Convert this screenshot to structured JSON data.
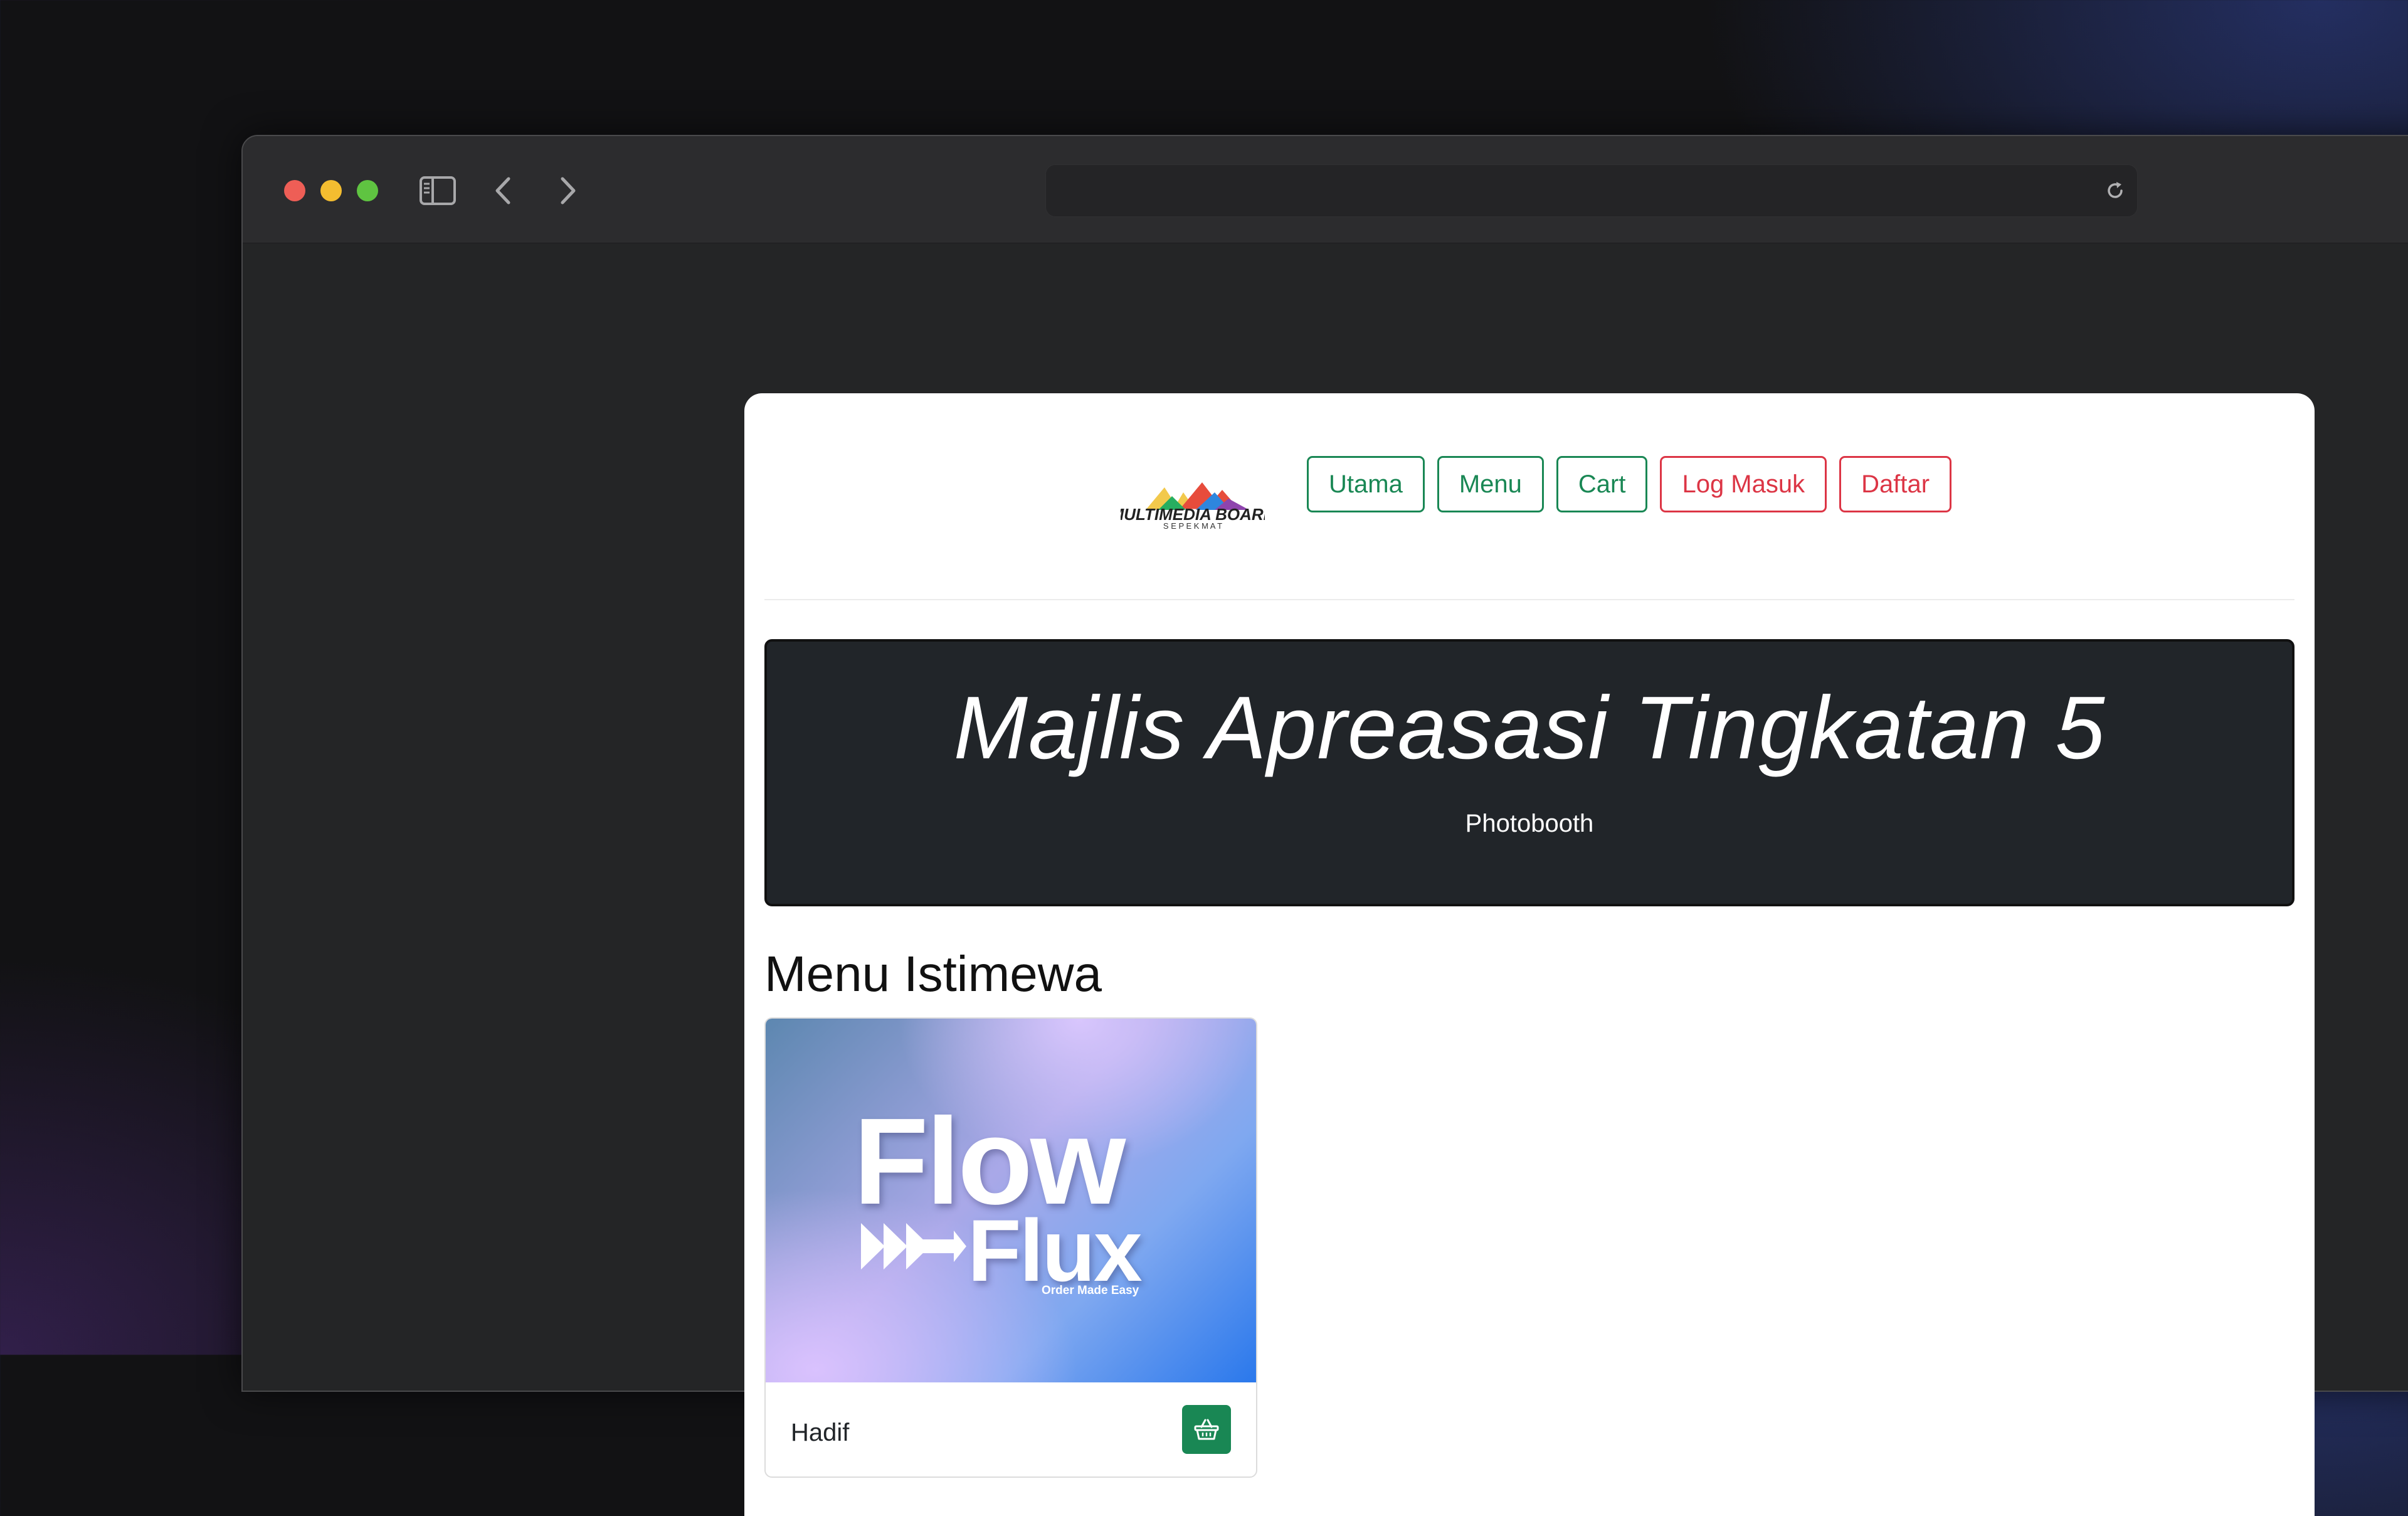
{
  "colors": {
    "success": "#198754",
    "danger": "#dc3545",
    "hero_bg": "#212529",
    "window_chrome": "#2c2c2e"
  },
  "browser": {
    "traffic_lights": [
      "close",
      "minimize",
      "maximize"
    ],
    "icons": [
      "sidebar-icon",
      "back-arrow-icon",
      "forward-arrow-icon",
      "reload-icon"
    ],
    "url": ""
  },
  "navbar": {
    "logo": {
      "icon": "multimedia-board-logo",
      "text_line1": "MULTIMEDIA BOARD",
      "text_line2": "S E P E K M A T"
    },
    "buttons": [
      {
        "label": "Utama",
        "variant": "success"
      },
      {
        "label": "Menu",
        "variant": "success"
      },
      {
        "label": "Cart",
        "variant": "success"
      },
      {
        "label": "Log Masuk",
        "variant": "danger"
      },
      {
        "label": "Daftar",
        "variant": "danger"
      }
    ]
  },
  "hero": {
    "title": "Majlis Apreasasi Tingkatan 5",
    "subtitle": "Photobooth"
  },
  "section": {
    "title": "Menu Istimewa"
  },
  "cards": [
    {
      "image": {
        "brand_line1": "Flow",
        "brand_line2": "Flux",
        "tagline": "Order Made Easy",
        "icon": "fast-forward-arrows-icon"
      },
      "name": "Hadif",
      "action_icon": "shopping-basket-icon"
    }
  ]
}
